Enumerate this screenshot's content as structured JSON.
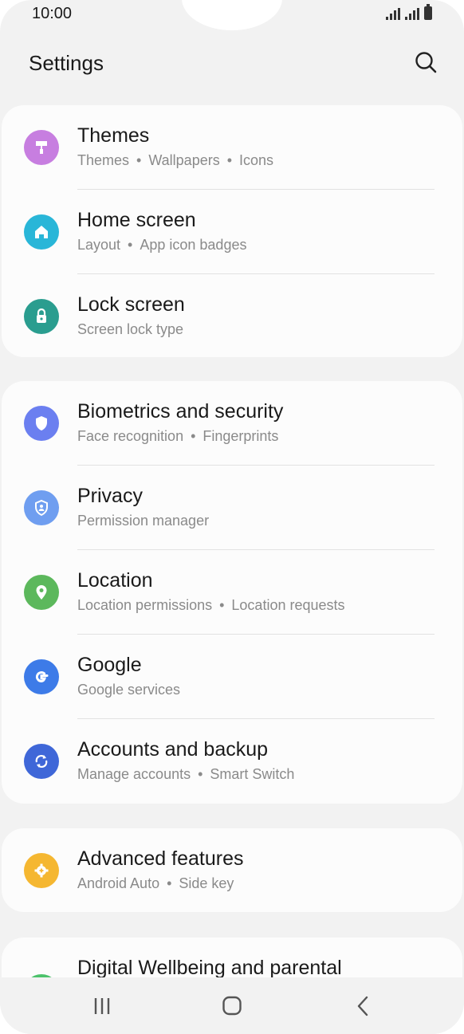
{
  "status_bar": {
    "time": "10:00"
  },
  "header": {
    "title": "Settings"
  },
  "groups": [
    {
      "items": [
        {
          "title": "Themes",
          "subtitle": [
            "Themes",
            "Wallpapers",
            "Icons"
          ],
          "icon": "themes-icon",
          "color": "#c77ee0"
        },
        {
          "title": "Home screen",
          "subtitle": [
            "Layout",
            "App icon badges"
          ],
          "icon": "home-icon",
          "color": "#29b6d8"
        },
        {
          "title": "Lock screen",
          "subtitle": [
            "Screen lock type"
          ],
          "icon": "lock-icon",
          "color": "#2a9d8f"
        }
      ]
    },
    {
      "items": [
        {
          "title": "Biometrics and security",
          "subtitle": [
            "Face recognition",
            "Fingerprints"
          ],
          "icon": "shield-icon",
          "color": "#6b7ff0"
        },
        {
          "title": "Privacy",
          "subtitle": [
            "Permission manager"
          ],
          "icon": "privacy-shield-icon",
          "color": "#6f9ef0"
        },
        {
          "title": "Location",
          "subtitle": [
            "Location permissions",
            "Location requests"
          ],
          "icon": "location-pin-icon",
          "color": "#5cb85c"
        },
        {
          "title": "Google",
          "subtitle": [
            "Google services"
          ],
          "icon": "google-icon",
          "color": "#3d7be8"
        },
        {
          "title": "Accounts and backup",
          "subtitle": [
            "Manage accounts",
            "Smart Switch"
          ],
          "icon": "sync-icon",
          "color": "#3f67d8"
        }
      ]
    },
    {
      "items": [
        {
          "title": "Advanced features",
          "subtitle": [
            "Android Auto",
            "Side key"
          ],
          "icon": "gear-plus-icon",
          "color": "#f5b731"
        }
      ]
    }
  ],
  "partial_item": {
    "title": "Digital Wellbeing and parental",
    "icon": "wellbeing-icon",
    "color": "#4cc26b"
  },
  "nav": {
    "recents": "recents-icon",
    "home": "home-nav-icon",
    "back": "back-icon"
  }
}
